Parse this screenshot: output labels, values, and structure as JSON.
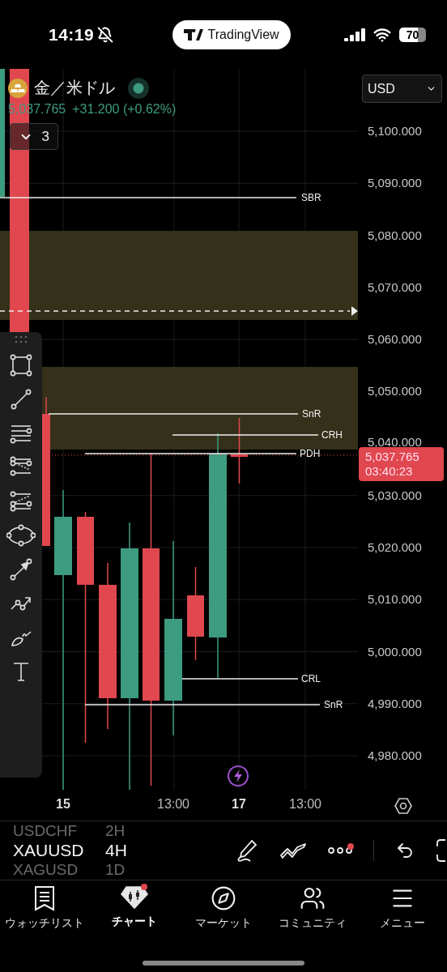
{
  "status_bar": {
    "time": "14:19",
    "muted": true,
    "app_pill": "TradingView",
    "battery": "70"
  },
  "legend": {
    "symbol": "金／米ドル",
    "market_open": true,
    "price": "5,037.765",
    "change": "+31.200 (+0.62%)",
    "indicators_toggle": "3"
  },
  "currency_select": {
    "value": "USD"
  },
  "price_axis": {
    "labels": [
      "5,100.000",
      "5,090.000",
      "5,080.000",
      "5,070.000",
      "5,060.000",
      "5,050.000",
      "5,040.000",
      "5,030.000",
      "5,020.000",
      "5,010.000",
      "5,000.000",
      "4,990.000",
      "4,980.000"
    ],
    "current_price": "5,037.765",
    "countdown": "03:40:23"
  },
  "levels": [
    {
      "label": "SBR"
    },
    {
      "label": "SnR"
    },
    {
      "label": "CRH"
    },
    {
      "label": "PDH"
    },
    {
      "label": "CRL"
    },
    {
      "label": "SnR"
    }
  ],
  "time_axis": [
    {
      "label": "15",
      "kind": "day"
    },
    {
      "label": "13:00",
      "kind": "time"
    },
    {
      "label": "17",
      "kind": "day"
    },
    {
      "label": "13:00",
      "kind": "time"
    }
  ],
  "symbol_picker": {
    "symbols": [
      {
        "label": "USDCHF",
        "selected": false
      },
      {
        "label": "XAUUSD",
        "selected": true
      },
      {
        "label": "XAGUSD",
        "selected": false
      }
    ],
    "intervals": [
      {
        "label": "2H",
        "selected": false
      },
      {
        "label": "4H",
        "selected": true
      },
      {
        "label": "1D",
        "selected": false
      }
    ]
  },
  "toolbar": {
    "more_notification": true
  },
  "tabs": [
    {
      "label": "ウォッチリスト",
      "selected": false,
      "notification": false
    },
    {
      "label": "チャート",
      "selected": true,
      "notification": true
    },
    {
      "label": "マーケット",
      "selected": false,
      "notification": false
    },
    {
      "label": "コミュニティ",
      "selected": false,
      "notification": false
    },
    {
      "label": "メニュー",
      "selected": false,
      "notification": false
    }
  ]
}
